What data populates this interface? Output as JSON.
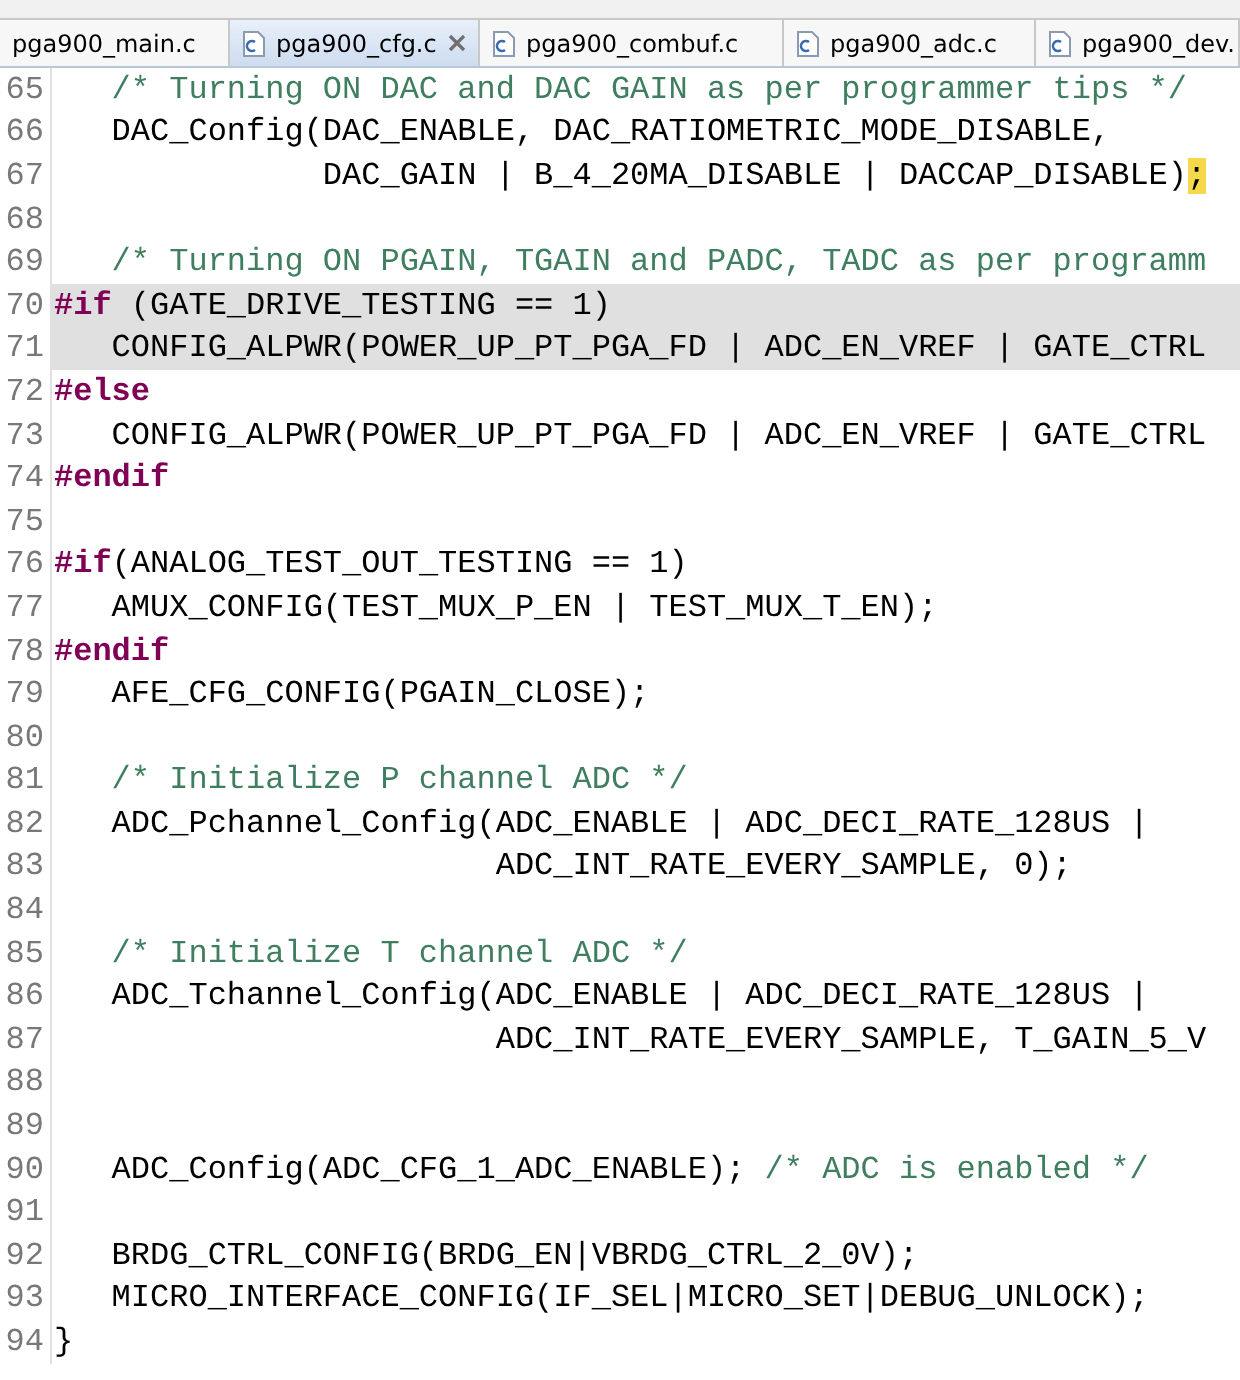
{
  "tabs": [
    {
      "label": "pga900_main.c",
      "selected": false,
      "icon": false
    },
    {
      "label": "pga900_cfg.c",
      "selected": true,
      "icon": true
    },
    {
      "label": "pga900_combuf.c",
      "selected": false,
      "icon": true
    },
    {
      "label": "pga900_adc.c",
      "selected": false,
      "icon": true
    },
    {
      "label": "pga900_dev.",
      "selected": false,
      "icon": true
    }
  ],
  "lines": [
    {
      "number": "65",
      "highlighted": false,
      "segments": [
        {
          "kind": "comment",
          "text": "   /* Turning ON DAC and DAC GAIN as per programmer tips */"
        }
      ]
    },
    {
      "number": "66",
      "highlighted": false,
      "segments": [
        {
          "kind": "plain",
          "text": "   DAC_Config(DAC_ENABLE, DAC_RATIOMETRIC_MODE_DISABLE,"
        }
      ]
    },
    {
      "number": "67",
      "highlighted": false,
      "segments": [
        {
          "kind": "plain",
          "text": "              DAC_GAIN | B_4_20MA_DISABLE | DACCAP_DISABLE)"
        },
        {
          "kind": "match",
          "text": ";"
        }
      ]
    },
    {
      "number": "68",
      "highlighted": false
    },
    {
      "number": "69",
      "highlighted": false,
      "segments": [
        {
          "kind": "comment",
          "text": "   /* Turning ON PGAIN, TGAIN and PADC, TADC as per programm"
        }
      ]
    },
    {
      "number": "70",
      "highlighted": true,
      "segments": [
        {
          "kind": "directive",
          "text": "#if"
        },
        {
          "kind": "plain",
          "text": " (GATE_DRIVE_TESTING == 1)"
        }
      ]
    },
    {
      "number": "71",
      "highlighted": true,
      "segments": [
        {
          "kind": "plain",
          "text": "   CONFIG_ALPWR(POWER_UP_PT_PGA_FD | ADC_EN_VREF | GATE_CTRL"
        }
      ]
    },
    {
      "number": "72",
      "highlighted": false,
      "segments": [
        {
          "kind": "directive",
          "text": "#else"
        }
      ]
    },
    {
      "number": "73",
      "highlighted": false,
      "segments": [
        {
          "kind": "plain",
          "text": "   CONFIG_ALPWR(POWER_UP_PT_PGA_FD | ADC_EN_VREF | GATE_CTRL"
        }
      ]
    },
    {
      "number": "74",
      "highlighted": false,
      "segments": [
        {
          "kind": "directive",
          "text": "#endif"
        }
      ]
    },
    {
      "number": "75",
      "highlighted": false
    },
    {
      "number": "76",
      "highlighted": false,
      "segments": [
        {
          "kind": "directive",
          "text": "#if"
        },
        {
          "kind": "plain",
          "text": "(ANALOG_TEST_OUT_TESTING == 1)"
        }
      ]
    },
    {
      "number": "77",
      "highlighted": false,
      "segments": [
        {
          "kind": "plain",
          "text": "   AMUX_CONFIG(TEST_MUX_P_EN | TEST_MUX_T_EN);"
        }
      ]
    },
    {
      "number": "78",
      "highlighted": false,
      "segments": [
        {
          "kind": "directive",
          "text": "#endif"
        }
      ]
    },
    {
      "number": "79",
      "highlighted": false,
      "segments": [
        {
          "kind": "plain",
          "text": "   AFE_CFG_CONFIG(PGAIN_CLOSE);"
        }
      ]
    },
    {
      "number": "80",
      "highlighted": false
    },
    {
      "number": "81",
      "highlighted": false,
      "segments": [
        {
          "kind": "comment",
          "text": "   /* Initialize P channel ADC */"
        }
      ]
    },
    {
      "number": "82",
      "highlighted": false,
      "segments": [
        {
          "kind": "plain",
          "text": "   ADC_Pchannel_Config(ADC_ENABLE | ADC_DECI_RATE_128US |"
        }
      ]
    },
    {
      "number": "83",
      "highlighted": false,
      "segments": [
        {
          "kind": "plain",
          "text": "                       ADC_INT_RATE_EVERY_SAMPLE, 0);"
        }
      ]
    },
    {
      "number": "84",
      "highlighted": false
    },
    {
      "number": "85",
      "highlighted": false,
      "segments": [
        {
          "kind": "comment",
          "text": "   /* Initialize T channel ADC */"
        }
      ]
    },
    {
      "number": "86",
      "highlighted": false,
      "segments": [
        {
          "kind": "plain",
          "text": "   ADC_Tchannel_Config(ADC_ENABLE | ADC_DECI_RATE_128US |"
        }
      ]
    },
    {
      "number": "87",
      "highlighted": false,
      "segments": [
        {
          "kind": "plain",
          "text": "                       ADC_INT_RATE_EVERY_SAMPLE, T_GAIN_5_V"
        }
      ]
    },
    {
      "number": "88",
      "highlighted": false
    },
    {
      "number": "89",
      "highlighted": false
    },
    {
      "number": "90",
      "highlighted": false,
      "segments": [
        {
          "kind": "plain",
          "text": "   ADC_Config(ADC_CFG_1_ADC_ENABLE); "
        },
        {
          "kind": "comment",
          "text": "/* ADC is enabled */"
        }
      ]
    },
    {
      "number": "91",
      "highlighted": false
    },
    {
      "number": "92",
      "highlighted": false,
      "segments": [
        {
          "kind": "plain",
          "text": "   BRDG_CTRL_CONFIG(BRDG_EN|VBRDG_CTRL_2_0V);"
        }
      ]
    },
    {
      "number": "93",
      "highlighted": false,
      "segments": [
        {
          "kind": "plain",
          "text": "   MICRO_INTERFACE_CONFIG(IF_SEL|MICRO_SET|DEBUG_UNLOCK);"
        }
      ]
    },
    {
      "number": "94",
      "highlighted": false,
      "segments": [
        {
          "kind": "plain",
          "text": "}"
        }
      ]
    }
  ]
}
